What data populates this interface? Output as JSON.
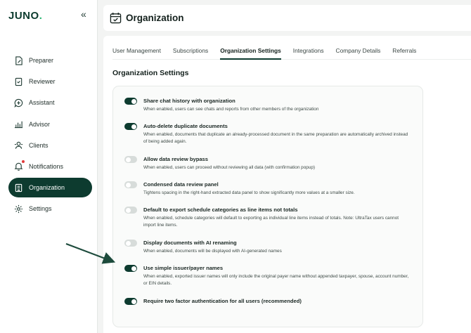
{
  "brand": {
    "name": "JUNO",
    "dot": "."
  },
  "sidebar": {
    "collapse_icon": "chevron-double-left-icon",
    "items": [
      {
        "label": "Preparer",
        "icon": "document-pen-icon",
        "active": false
      },
      {
        "label": "Reviewer",
        "icon": "document-check-icon",
        "active": false
      },
      {
        "label": "Assistant",
        "icon": "chat-plus-icon",
        "active": false
      },
      {
        "label": "Advisor",
        "icon": "bar-chart-icon",
        "active": false
      },
      {
        "label": "Clients",
        "icon": "users-icon",
        "active": false
      },
      {
        "label": "Notifications",
        "icon": "bell-icon",
        "active": false
      },
      {
        "label": "Organization",
        "icon": "building-icon",
        "active": true
      },
      {
        "label": "Settings",
        "icon": "gear-icon",
        "active": false
      }
    ]
  },
  "header": {
    "title": "Organization",
    "icon": "calendar-check-icon"
  },
  "tabs": [
    {
      "label": "User Management",
      "active": false
    },
    {
      "label": "Subscriptions",
      "active": false
    },
    {
      "label": "Organization Settings",
      "active": true
    },
    {
      "label": "Integrations",
      "active": false
    },
    {
      "label": "Company Details",
      "active": false
    },
    {
      "label": "Referrals",
      "active": false
    }
  ],
  "section_title": "Organization Settings",
  "settings": [
    {
      "title": "Share chat history with organization",
      "desc": "When enabled, users can see chats and reports from other members of the organization",
      "on": true
    },
    {
      "title": "Auto-delete duplicate documents",
      "desc": "When enabled, documents that duplicate an already-processed document in the same preparation are automatically archived instead of being added again.",
      "on": true
    },
    {
      "title": "Allow data review bypass",
      "desc": "When enabled, users can proceed without reviewing all data (with confirmation popup)",
      "on": false
    },
    {
      "title": "Condensed data review panel",
      "desc": "Tightens spacing in the right-hand extracted data panel to show significantly more values at a smaller size.",
      "on": false
    },
    {
      "title": "Default to export schedule categories as line items not totals",
      "desc": "When enabled, schedule categories will default to exporting as individual line items instead of totals. Note: UltraTax users cannot import line items.",
      "on": false
    },
    {
      "title": "Display documents with AI renaming",
      "desc": "When enabled, documents will be displayed with AI-generated names",
      "on": false
    },
    {
      "title": "Use simple issuer/payer names",
      "desc": "When enabled, exported issuer names will only include the original payer name without appended taxpayer, spouse, account number, or EIN details.",
      "on": true
    },
    {
      "title": "Require two factor authentication for all users (recommended)",
      "desc": "",
      "on": true
    }
  ],
  "colors": {
    "brand_dark": "#0d3b2f",
    "brand_accent": "#2bb673",
    "toggle_off": "#d7dcda",
    "notification_dot": "#e03a3a"
  }
}
